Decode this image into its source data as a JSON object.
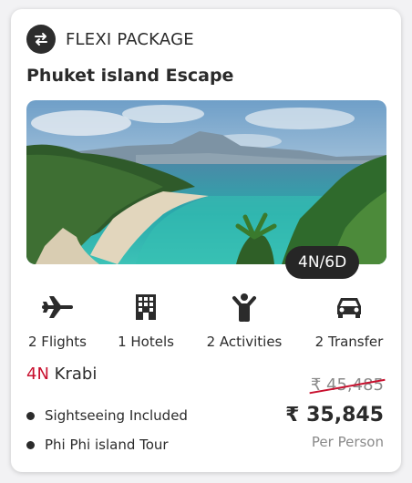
{
  "package": {
    "type_label": "FLEXI PACKAGE",
    "icon": "swap-arrows-icon",
    "title": "Phuket island Escape",
    "duration": "4N/6D"
  },
  "amenities": [
    {
      "icon": "airplane-icon",
      "label": "2 Flights"
    },
    {
      "icon": "hotel-building-icon",
      "label": "1 Hotels"
    },
    {
      "icon": "activity-person-icon",
      "label": "2 Activities"
    },
    {
      "icon": "car-icon",
      "label": "2 Transfer"
    }
  ],
  "destination": {
    "nights": "4N",
    "city": "Krabi"
  },
  "inclusions": [
    "Sightseeing Included",
    "Phi Phi island Tour"
  ],
  "pricing": {
    "original": "₹ 45,485",
    "current": "₹ 35,845",
    "unit": "Per Person"
  },
  "colors": {
    "accent": "#c8102e",
    "dark": "#2b2b2b",
    "muted": "#8a8a8a"
  }
}
